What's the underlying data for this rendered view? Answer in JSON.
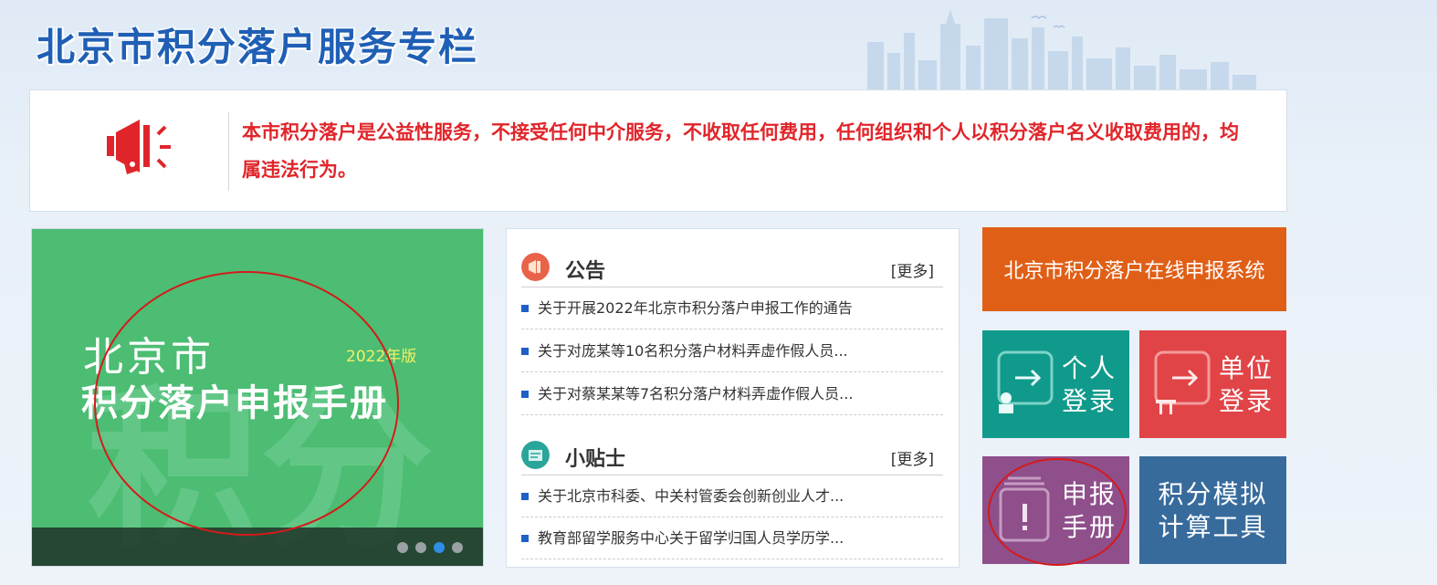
{
  "header": {
    "title": "北京市积分落户服务专栏"
  },
  "notice": {
    "text": "本市积分落户是公益性服务，不接受任何中介服务，不收取任何费用，任何组织和个人以积分落户名义收取费用的，均属违法行为。"
  },
  "carousel": {
    "city": "北京市",
    "year": "2022年版",
    "title": "积分落户申报手册",
    "background_char": "积分",
    "slide_count": 4,
    "active_index": 2
  },
  "announcements": {
    "title": "公告",
    "more": "[更多]",
    "items": [
      "关于开展2022年北京市积分落户申报工作的通告",
      "关于对庞某等10名积分落户材料弄虚作假人员...",
      "关于对蔡某某等7名积分落户材料弄虚作假人员..."
    ]
  },
  "tips": {
    "title": "小贴士",
    "more": "[更多]",
    "items": [
      "关于北京市科委、中关村管委会创新创业人才...",
      "教育部留学服务中心关于留学归国人员学历学..."
    ]
  },
  "tiles": {
    "online": "北京市积分落户在线申报系统",
    "person": [
      "个人",
      "登录"
    ],
    "unit": [
      "单位",
      "登录"
    ],
    "manual": [
      "申报",
      "手册"
    ],
    "calc": [
      "积分模拟",
      "计算工具"
    ]
  },
  "colors": {
    "title_blue": "#1f5fb5",
    "warning_red": "#e0252a",
    "online_orange": "#e05f17",
    "person_teal": "#109a8b",
    "unit_red": "#e14447",
    "manual_purple": "#8e4f8b",
    "calc_blue": "#376b9c",
    "carousel_green": "#4cbd73"
  }
}
